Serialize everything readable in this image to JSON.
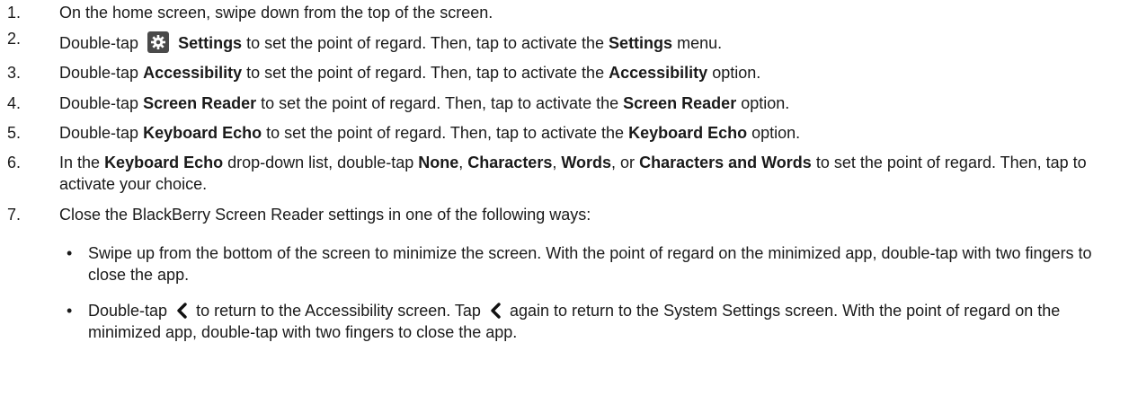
{
  "steps": [
    {
      "num": "1.",
      "text": "On the home screen, swipe down from the top of the screen."
    },
    {
      "num": "2.",
      "a": "Double-tap",
      "b": "Settings",
      "c": "to set the point of regard. Then, tap to activate the",
      "d": "Settings",
      "e": "menu."
    },
    {
      "num": "3.",
      "a": "Double-tap",
      "b": "Accessibility",
      "c": "to set the point of regard. Then, tap to activate the",
      "d": "Accessibility",
      "e": "option."
    },
    {
      "num": "4.",
      "a": "Double-tap",
      "b": "Screen Reader",
      "c": "to set the point of regard. Then, tap to activate the",
      "d": "Screen Reader",
      "e": "option."
    },
    {
      "num": "5.",
      "a": "Double-tap",
      "b": "Keyboard Echo",
      "c": "to set the point of regard. Then, tap to activate the",
      "d": "Keyboard Echo",
      "e": "option."
    },
    {
      "num": "6.",
      "a": "In the",
      "b": "Keyboard Echo",
      "c": "drop-down list, double-tap",
      "d": "None",
      "e": ",",
      "f": "Characters",
      "g": ",",
      "h": "Words",
      "i": ", or",
      "j": "Characters and Words",
      "k": "to set the point of regard. Then, tap to activate your choice."
    },
    {
      "num": "7.",
      "text": "Close the BlackBerry Screen Reader settings in one of the following ways:"
    }
  ],
  "bullets": [
    {
      "dot": "•",
      "text": "Swipe up from the bottom of the screen to minimize the screen. With the point of regard on the minimized app, double-tap with two fingers to close the app."
    },
    {
      "dot": "•",
      "a": "Double-tap",
      "b": "to return to the Accessibility screen. Tap",
      "c": "again to return to the System Settings screen. With the point of regard on the minimized app, double-tap with two fingers to close the app."
    }
  ],
  "icons": {
    "settings": "gear-icon",
    "back": "chevron-left-icon",
    "icon_bg": "#4a4a4a"
  }
}
